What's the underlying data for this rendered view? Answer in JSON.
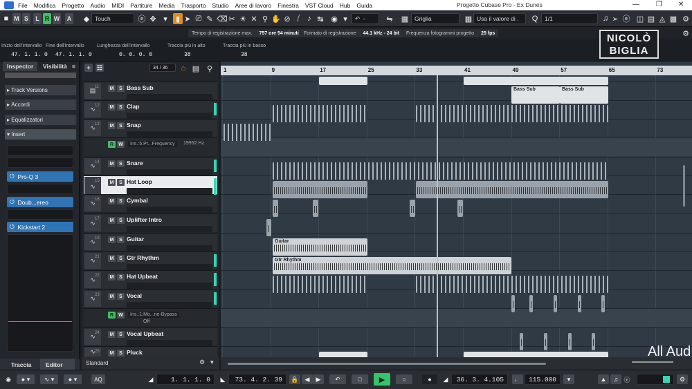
{
  "menubar": {
    "items": [
      "File",
      "Modifica",
      "Progetto",
      "Audio",
      "MIDI",
      "Partiture",
      "Media",
      "Trasporto",
      "Studio",
      "Aree di lavoro",
      "Finestra",
      "VST Cloud",
      "Hub",
      "Guida"
    ],
    "window_title": "Progetto Cubase Pro - Ex Dunes",
    "min_icon": "minimize-icon",
    "max_icon": "maximize-icon",
    "close_icon": "close-icon"
  },
  "toolbar": {
    "m": "M",
    "s": "S",
    "l": "L",
    "r": "R",
    "w": "W",
    "a": "A",
    "automation_mode": "Touch",
    "grid_type": "Griglia",
    "quantize_mode": "Usa il valore di .",
    "quantize_value": "1/1"
  },
  "infostrip": {
    "rec_time_label": "Tempo di registrazione max.",
    "rec_time_value": "757 ore 54 minuti",
    "rec_format_label": "Formato di registrazione",
    "rec_format_value": "44.1 kHz - 24 bit",
    "fps_label": "Frequenza fotogrammi progetto",
    "fps_value": "25 fps"
  },
  "infoline": {
    "range_start_label": "Inizio dell'intervallo",
    "range_start_value": "47. 1. 1. 0",
    "range_end_label": "Fine dell'intervallo",
    "range_end_value": "47. 1. 1. 0",
    "range_length_label": "Lunghezza dell'intervallo",
    "range_length_value": "0. 0. 0. 0",
    "track_top_label": "Traccia più in alto",
    "track_top_value": "38",
    "track_bottom_label": "Traccia più in basso",
    "track_bottom_value": "38"
  },
  "brand": {
    "line1": "NICOLÒ",
    "line2": "BIGLIA"
  },
  "inspector": {
    "tab_inspector": "Inspector",
    "tab_visibility": "Visibilità",
    "sections": [
      "Track Versions",
      "Accordi",
      "Equalizzatori",
      "Insert"
    ],
    "inserts": [
      "Pro-Q 3",
      "Doub...ereo",
      "Kickstart 2"
    ],
    "bottom_tab_track": "Traccia",
    "bottom_tab_editor": "Editor"
  },
  "tracklist": {
    "count": "34 / 36",
    "footer": "Standard",
    "tracks": [
      {
        "num": "11",
        "name": "Bass Sub"
      },
      {
        "num": "12",
        "name": "Clap"
      },
      {
        "num": "13",
        "name": "Snap"
      },
      {
        "num": "14",
        "name": "Snare"
      },
      {
        "num": "15",
        "name": "Hat Loop"
      },
      {
        "num": "16",
        "name": "Cymbal"
      },
      {
        "num": "17",
        "name": "Uplifter Intro"
      },
      {
        "num": "19",
        "name": "Guitar"
      },
      {
        "num": "21",
        "name": "Gtr Rhythm"
      },
      {
        "num": "22",
        "name": "Hat Upbeat"
      },
      {
        "num": "23",
        "name": "Vocal"
      },
      {
        "num": "24",
        "name": "Vocal Upbeat"
      },
      {
        "num": "25",
        "name": "Pluck"
      }
    ],
    "auto1_param": "Ins.:5:Pr...Frequency",
    "auto1_value": "19952 Hz",
    "auto2_param": "Ins.:1:Mo...ne-Bypass",
    "auto2_value": "Off"
  },
  "ruler": {
    "marks": [
      "1",
      "9",
      "17",
      "25",
      "33",
      "41",
      "49",
      "57",
      "65",
      "73"
    ]
  },
  "parts": {
    "bass_sub_1": "Bass Sub",
    "bass_sub_2": "Bass Sub",
    "guitar": "Guitar",
    "gtr_rhythm": "Gtr Rhythm"
  },
  "bottombar": {
    "left_locator": "1. 1. 1. 0",
    "right_locator": "73. 4. 2. 39",
    "position": "36. 3. 4.105",
    "tempo": "115.000",
    "aq": "AQ"
  },
  "overlay_text": "All Aud"
}
